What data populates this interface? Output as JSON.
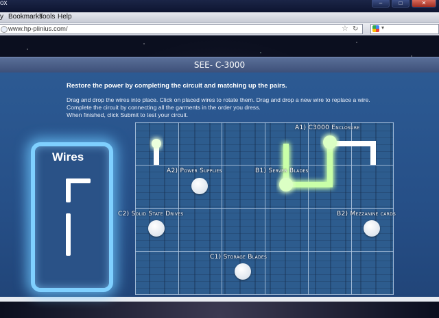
{
  "browser": {
    "window_title": "ox",
    "menu": [
      "y",
      "Bookmarks",
      "Tools",
      "Help"
    ],
    "url": "www.hp-plinius.com/"
  },
  "app": {
    "title": "SEE- C-3000",
    "headline": "Restore the power by completing the circuit and matching up the pairs.",
    "instructions": [
      "Drag and drop the wires into place.  Click on placed wires to rotate them. Drag and drop a new wire to replace a wire.",
      "Complete the circuit by connecting all the garments in the order you dress.",
      "When finished, click Submit to test your circuit."
    ],
    "wires_title": "Wires",
    "nodes": {
      "a1": "A1) C3000 Enclosure",
      "a2": "A2) Power Supplies",
      "b1": "B1) Server Blades",
      "b2": "B2) Mezzanine cards",
      "c1": "C1) Storage Blades",
      "c2": "C2) Solid State Drives"
    }
  },
  "colors": {
    "panel": "#2c5a93",
    "glow_wire": "#b6ff8e",
    "placed_wire": "#ffffff",
    "wires_box_glow": "#7fd0ff"
  },
  "icons": {
    "star": "star-icon",
    "refresh": "refresh-icon",
    "search_engine": "google-icon"
  }
}
